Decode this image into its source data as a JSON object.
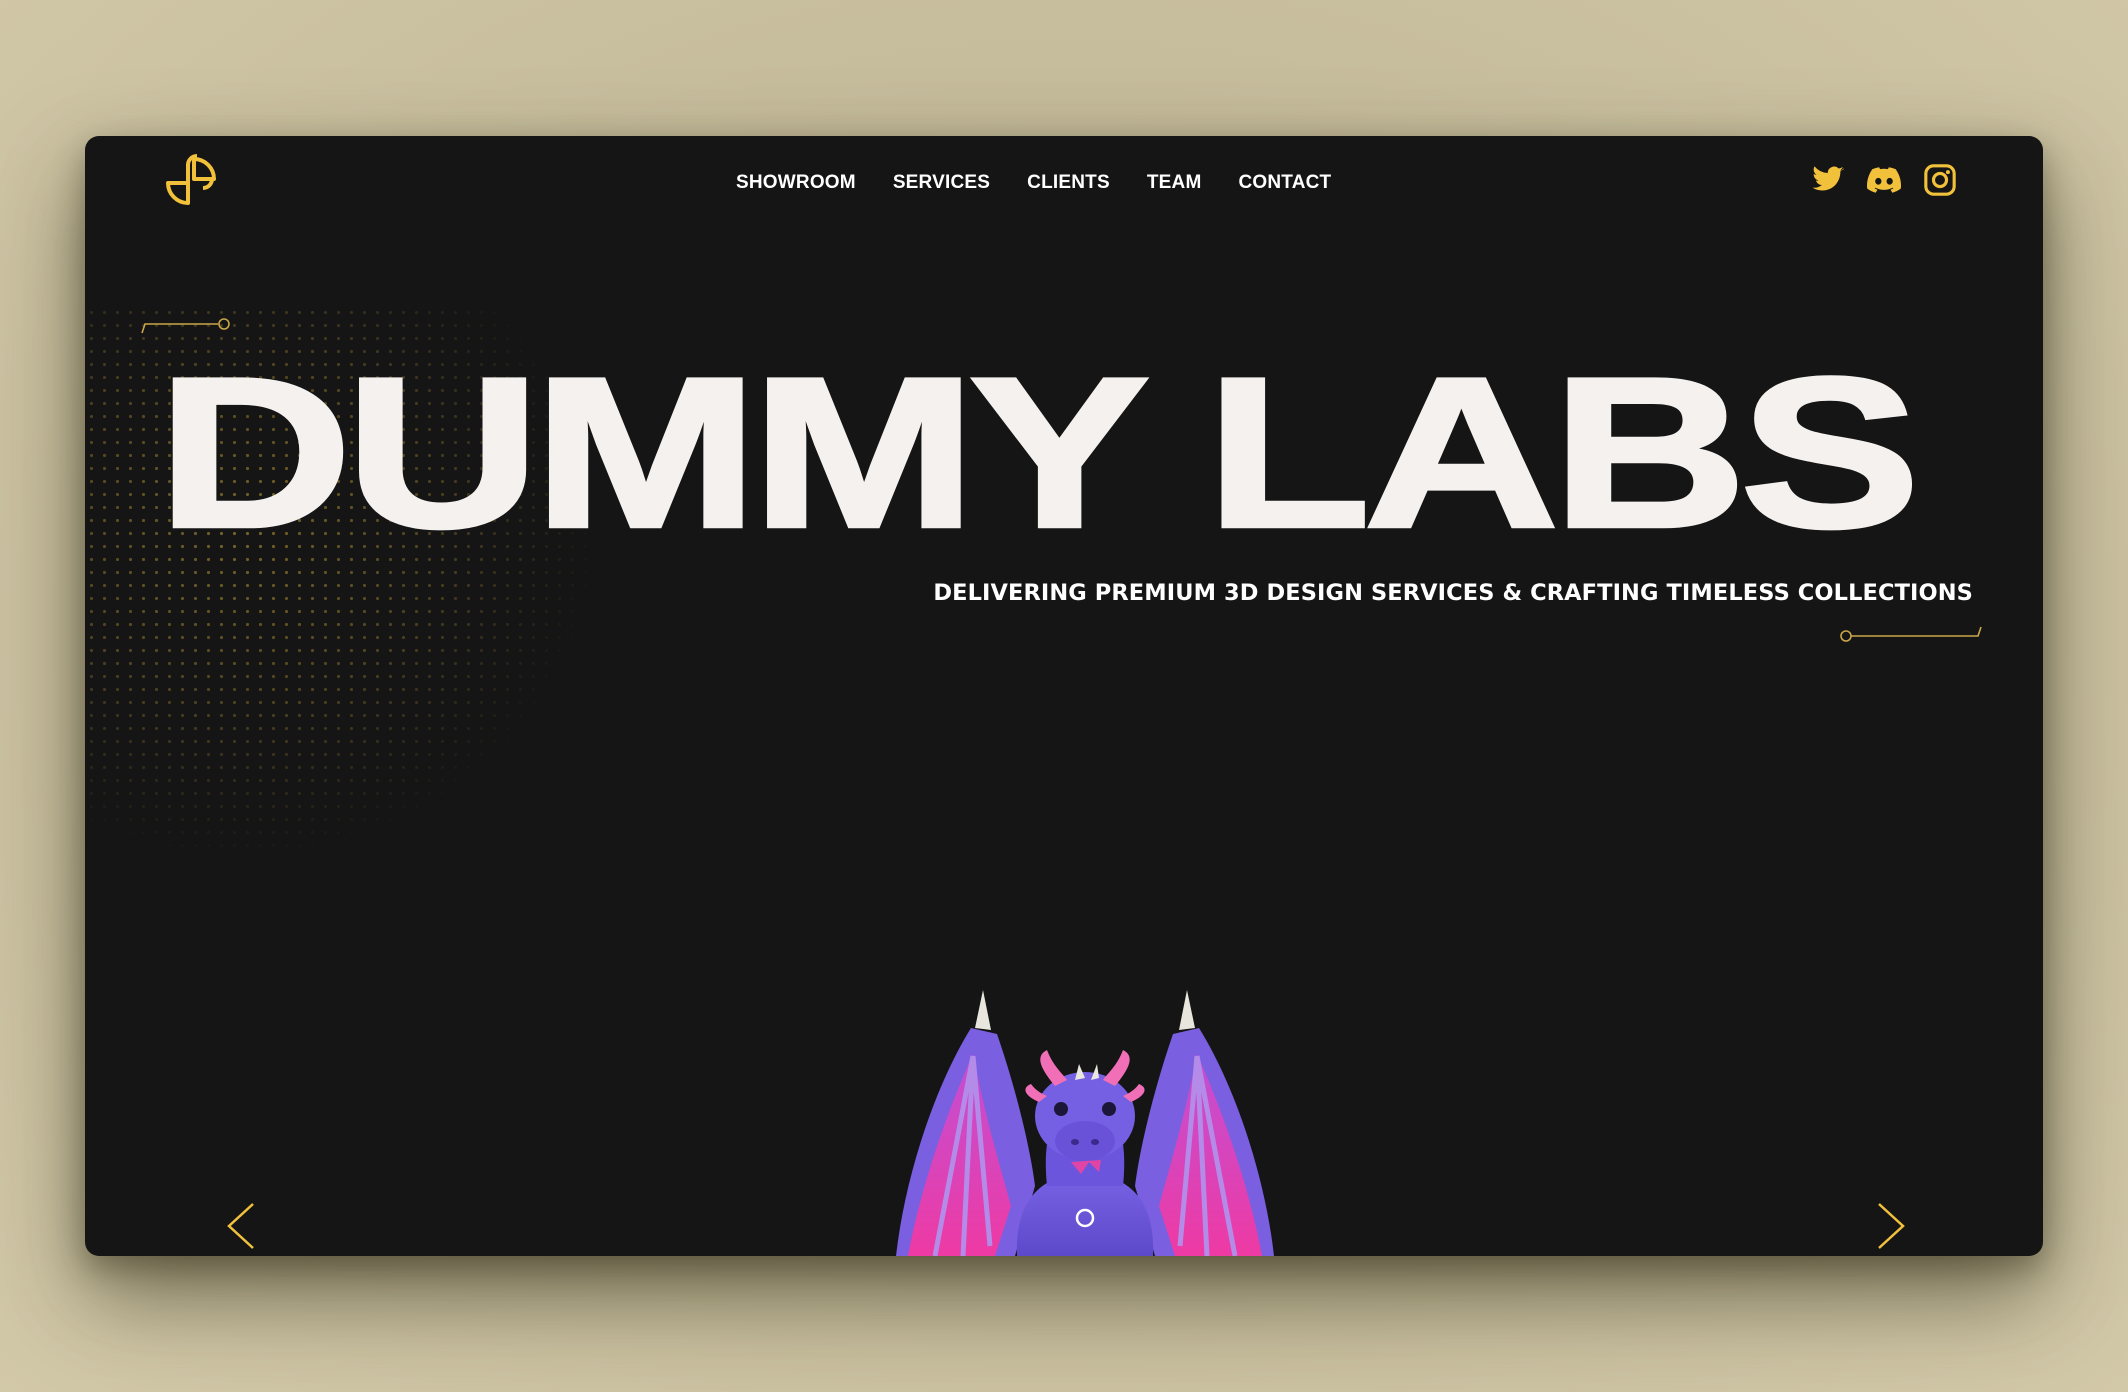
{
  "nav": {
    "items": [
      "SHOWROOM",
      "SERVICES",
      "CLIENTS",
      "TEAM",
      "CONTACT"
    ]
  },
  "social": {
    "icons": [
      "twitter-icon",
      "discord-icon",
      "instagram-icon"
    ]
  },
  "hero": {
    "title": "DUMMY LABS",
    "tagline": "DELIVERING PREMIUM 3D DESIGN SERVICES & CRAFTING TIMELESS COLLECTIONS"
  },
  "showcase": {
    "model": "purple dragon",
    "prev_icon": "chevron-left-icon",
    "next_icon": "chevron-right-icon"
  },
  "colors": {
    "accent": "#f2c13b",
    "background": "#151515",
    "text": "#f4f1ee",
    "desktop": "#c9c0a0"
  }
}
